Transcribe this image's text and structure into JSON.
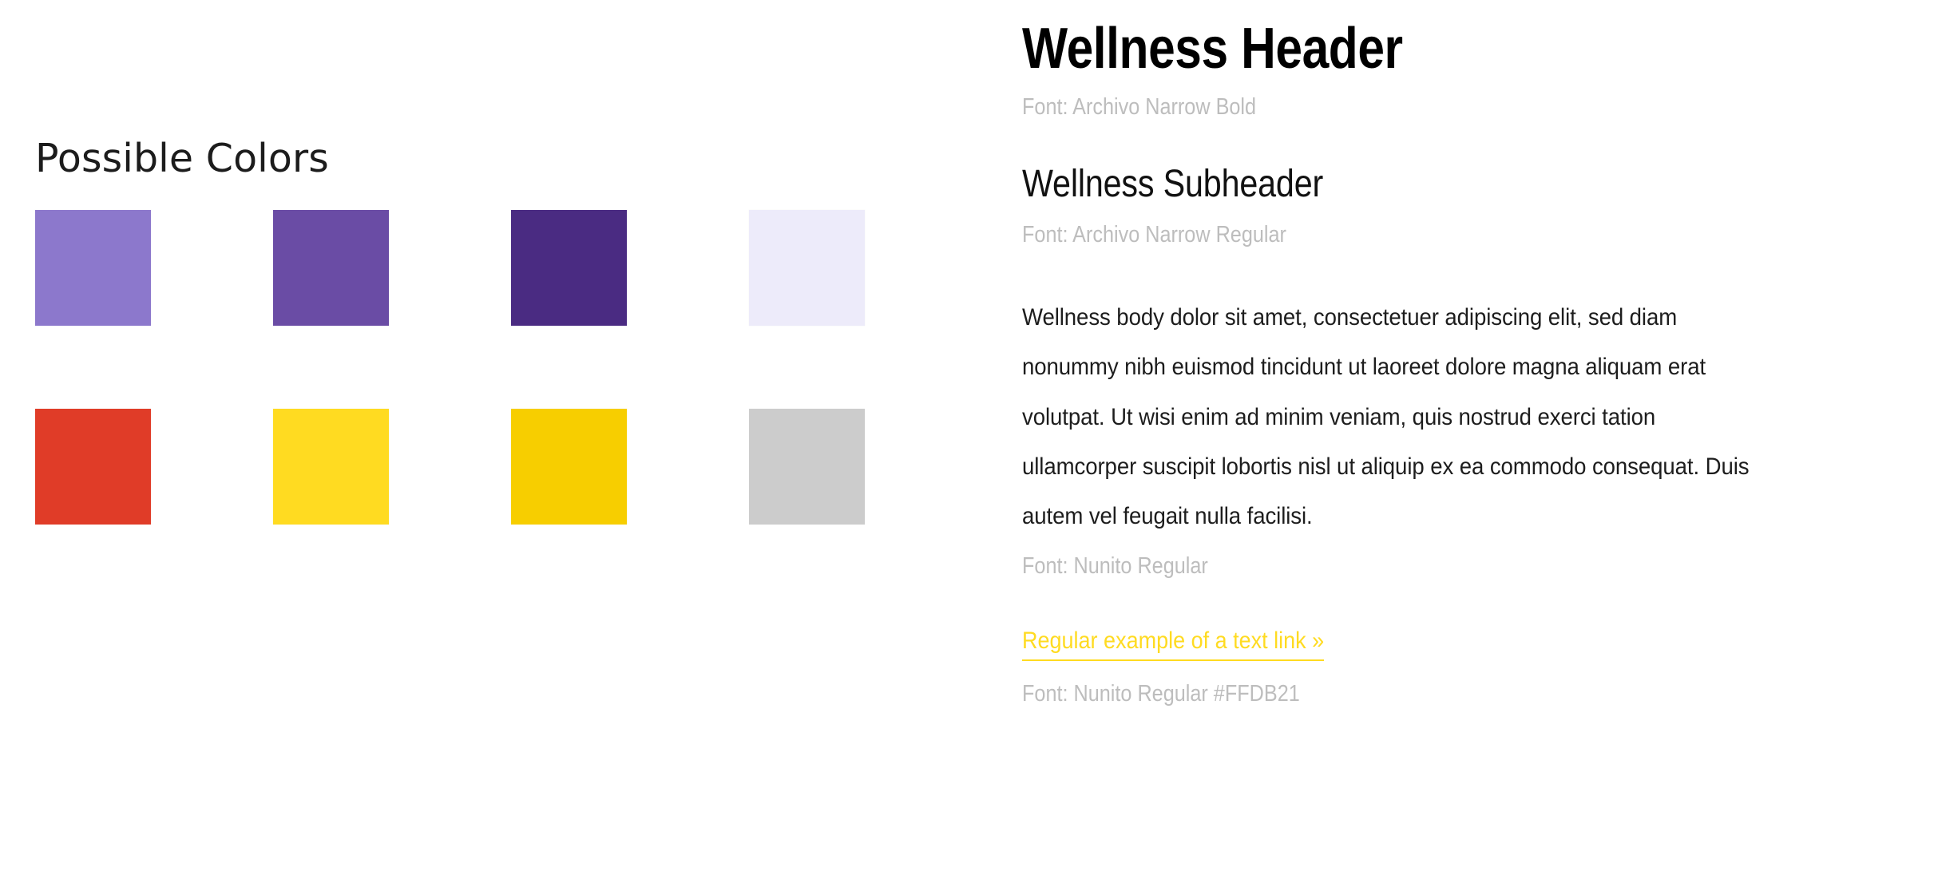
{
  "palette": {
    "title": "Possible Colors",
    "rows": [
      {
        "name": "purple-row",
        "swatches": [
          {
            "name": "swatch-light-purple",
            "hex": "#8C78CC"
          },
          {
            "name": "swatch-medium-purple",
            "hex": "#6A4CA5"
          },
          {
            "name": "swatch-dark-purple",
            "hex": "#4A2B82"
          },
          {
            "name": "swatch-pale-lavender",
            "hex": "#EDEBFA"
          }
        ]
      },
      {
        "name": "accent-row",
        "swatches": [
          {
            "name": "swatch-red",
            "hex": "#E03C28"
          },
          {
            "name": "swatch-bright-yellow",
            "hex": "#FFDB21"
          },
          {
            "name": "swatch-gold",
            "hex": "#F7CE00"
          },
          {
            "name": "swatch-gray",
            "hex": "#CCCCCC"
          }
        ]
      }
    ]
  },
  "typography": {
    "header": {
      "text": "Wellness Header",
      "caption": "Font: Archivo Narrow Bold"
    },
    "subheader": {
      "text": "Wellness Subheader",
      "caption": "Font: Archivo Narrow Regular"
    },
    "body": {
      "text": "Wellness body dolor sit amet, consectetuer adipiscing elit, sed diam nonummy nibh euismod tincidunt ut laoreet dolore magna aliquam erat volutpat. Ut wisi enim ad minim veniam, quis nostrud exerci tation ullamcorper suscipit lobortis nisl ut aliquip ex ea commodo consequat. Duis autem vel feugait nulla facilisi.",
      "caption": "Font: Nunito Regular"
    },
    "link": {
      "text": "Regular example of a text link »",
      "caption": "Font: Nunito Regular #FFDB21",
      "color": "#FFDB21"
    }
  }
}
